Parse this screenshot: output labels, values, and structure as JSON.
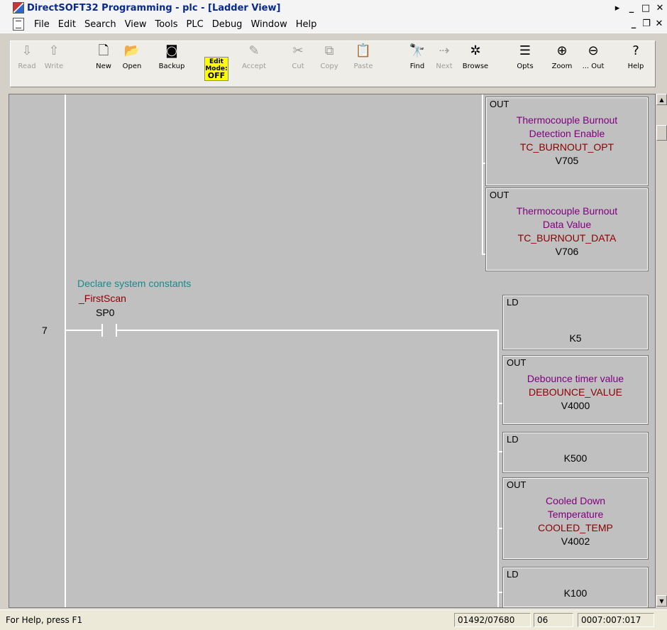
{
  "window": {
    "title": "DirectSOFT32 Programming - plc - [Ladder View]"
  },
  "menu": [
    "File",
    "Edit",
    "Search",
    "View",
    "Tools",
    "PLC",
    "Debug",
    "Window",
    "Help"
  ],
  "toolbar": {
    "read": "Read",
    "write": "Write",
    "new": "New",
    "open": "Open",
    "backup": "Backup",
    "edit_mode_line1": "Edit",
    "edit_mode_line2": "Mode:",
    "edit_mode_state": "OFF",
    "accept": "Accept",
    "cut": "Cut",
    "copy": "Copy",
    "paste": "Paste",
    "find": "Find",
    "next": "Next",
    "browse": "Browse",
    "opts": "Opts",
    "zoom": "Zoom",
    "zoom_out": "... Out",
    "help": "Help"
  },
  "ladder": {
    "top_boxes": [
      {
        "op": "OUT",
        "desc1": "Thermocouple Burnout",
        "desc2": "Detection Enable",
        "nick": "TC_BURNOUT_OPT",
        "addr": "V705"
      },
      {
        "op": "OUT",
        "desc1": "Thermocouple Burnout",
        "desc2": "Data Value",
        "nick": "TC_BURNOUT_DATA",
        "addr": "V706"
      }
    ],
    "rung7": {
      "number": "7",
      "comment": "Declare system constants",
      "contact_nick": "_FirstScan",
      "contact_addr": "SP0",
      "boxes": [
        {
          "op": "LD",
          "value": "K5"
        },
        {
          "op": "OUT",
          "desc1": "Debounce timer value",
          "nick": "DEBOUNCE_VALUE",
          "addr": "V4000"
        },
        {
          "op": "LD",
          "value": "K500"
        },
        {
          "op": "OUT",
          "desc1": "Cooled Down",
          "desc2": "Temperature",
          "nick": "COOLED_TEMP",
          "addr": "V4002"
        },
        {
          "op": "LD",
          "value": "K100"
        }
      ]
    }
  },
  "status": {
    "help": "For Help, press F1",
    "memory": "01492/07680",
    "mode": "06",
    "position": "0007:007:017"
  }
}
